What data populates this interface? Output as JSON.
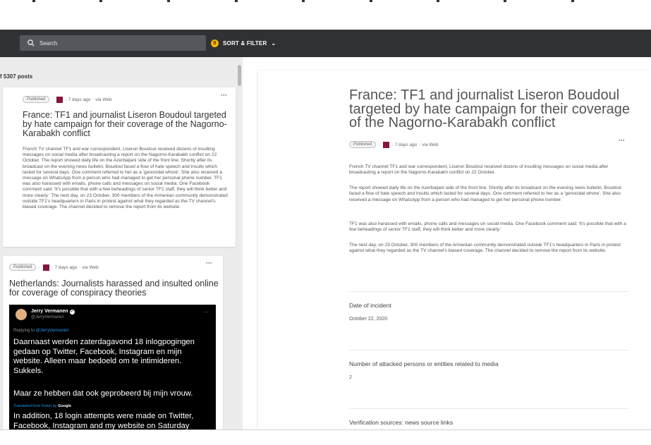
{
  "nav": {
    "search_label": "Search",
    "sort_filter_label": "SORT & FILTER",
    "sort_filter_badge": "0"
  },
  "feed": {
    "post_count": "f 5307 posts",
    "posts": [
      {
        "status": "Published",
        "time": "· 7 days ago",
        "via": "· via Web",
        "title": "France: TF1 and journalist Liseron Boudoul targeted by hate campaign for their coverage of the Nagorno-Karabakh conflict",
        "body": "French TV channel TF1 and war correspondent, Liseron Boudoul received dozens of insulting messages on social media after broadcasting a report on the Nagorno-Karabakh conflict on 22 October. The report showed daily life on the Azerbaijani side of the front line. Shortly after its broadcast on the evening news bulletin, Boudoul faced a flow of hate speech and insults which lasted for several days. One comment referred to her as a 'genocidal whore'. She also received a message on WhatsApp from a person who had managed to get her personal phone number. TF1 was also harassed with emails, phone calls and messages on social media. One Facebook comment said: 'It's possible that with a few beheadings of senior TF1 staff, they will think better and more clearly.' The next day, on 23 October, 300 members of the Armenian community demonstrated outside TF1's headquarters in Paris in protest against what they regarded as the TV channel's biased coverage. The channel decided to remove the report from its website."
      },
      {
        "status": "Published",
        "time": "· 7 days ago",
        "via": "· via Web",
        "title": "Netherlands: Journalists harassed and insulted online for coverage of conspiracy theories",
        "tweet": {
          "name": "Jerry Vermanen",
          "handle": "@JerryVermanen",
          "replying_prefix": "Replying to",
          "replying_to": "@JerryVermanen",
          "text1": "Daarnaast werden zaterdagavond 18 inlogpogingen gedaan op Twitter, Facebook, Instagram en mijn website. Alleen maar bedoeld om te intimideren. Sukkels.",
          "text2": "Maar ze hebben dat ook geprobeerd bij mijn vrouw.",
          "translated_prefix": "Translated from Dutch by",
          "translated_by": "Google",
          "text3": "In addition, 18 login attempts were made on Twitter, Facebook, Instagram and my website on Saturday"
        }
      }
    ]
  },
  "detail": {
    "title": "France: TF1 and journalist Liseron Boudoul targeted by hate campaign for their coverage of the Nagorno-Karabakh conflict",
    "status": "Published",
    "time": "· 7 days ago",
    "via": "· via Web",
    "paragraphs": [
      "French TV channel TF1 and war correspondent, Liseron Boudoul received dozens of insulting messages on social media after broadcasting a report on the Nagorno-Karabakh conflict on 22 October.",
      "The report showed daily life on the Azerbaijani side of the front line. Shortly after its broadcast on the evening news bulletin, Boudoul faced a flow of hate speech and insults which lasted for several days. One comment referred to her as a 'genocidal whore'. She also received a message on WhatsApp from a person who had managed to get her personal phone number.",
      "TF1 was also harassed with emails, phone calls and messages on social media. One Facebook comment said: 'It's possible that with a few beheadings of senior TF1 staff, they will think better and more clearly.'",
      "The next day, on 23 October, 300 members of the Armenian community demonstrated outside TF1's headquarters in Paris in protest against what they regarded as the TV channel's biased coverage. The channel decided to remove the report from its website."
    ],
    "fields": [
      {
        "label": "Date of incident",
        "value": "October 22, 2020"
      },
      {
        "label": "Number of attacked persons or entities related to media",
        "value": "2"
      },
      {
        "label": "Verification sources: news source links",
        "value": ""
      }
    ]
  },
  "colors": {
    "navbar": "#2f3134",
    "badge": "#f4b400",
    "avatar": "#8a1538"
  }
}
